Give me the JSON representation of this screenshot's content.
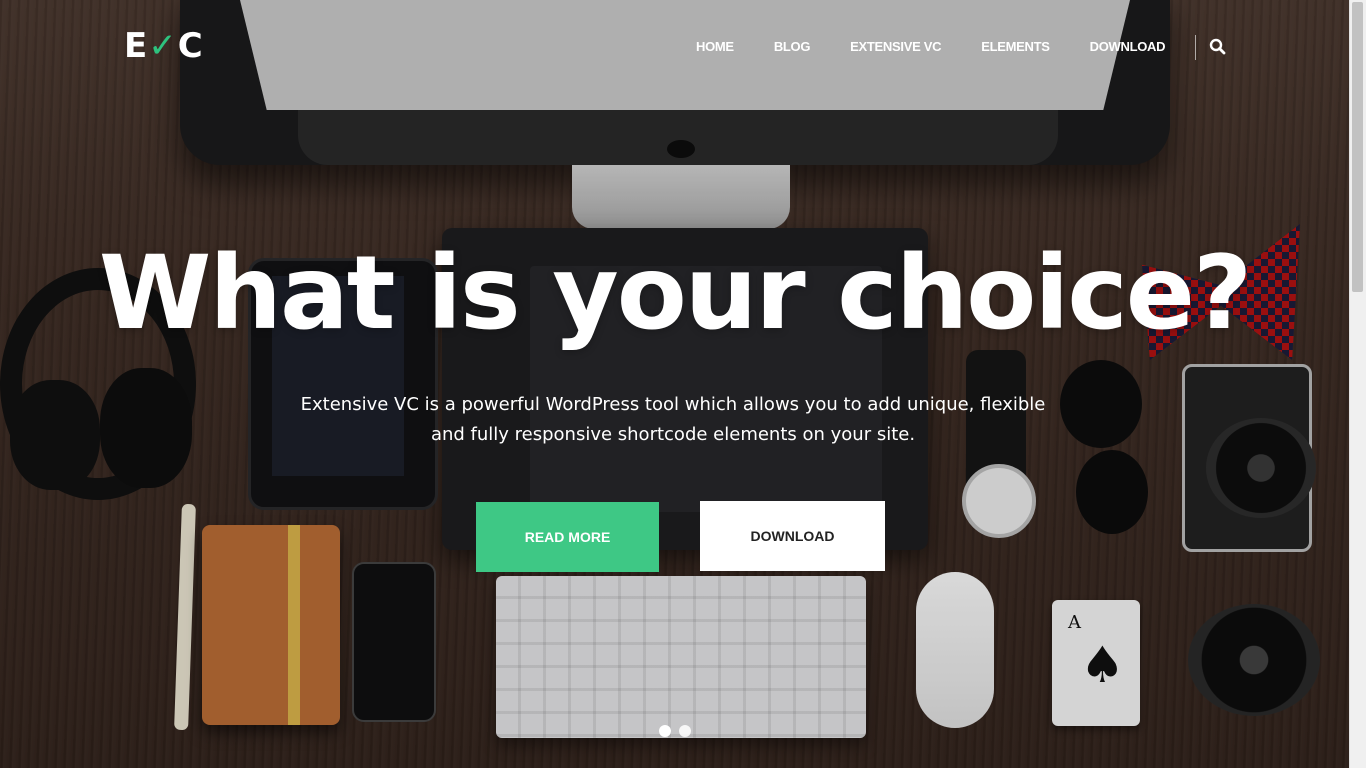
{
  "header": {
    "logo": {
      "prefix": "E",
      "check": "✓",
      "suffix": "C"
    },
    "nav": [
      {
        "label": "HOME"
      },
      {
        "label": "BLOG"
      },
      {
        "label": "EXTENSIVE VC"
      },
      {
        "label": "ELEMENTS"
      },
      {
        "label": "DOWNLOAD"
      }
    ],
    "search_icon": "search-icon"
  },
  "hero": {
    "headline": "What is your choice?",
    "subtext_line1": "Extensive VC is a powerful WordPress tool which allows you to add unique, flexible",
    "subtext_line2": "and fully responsive shortcode elements on your site.",
    "buttons": {
      "read_more": "READ MORE",
      "download": "DOWNLOAD"
    },
    "slider": {
      "dots": 2,
      "active": 1
    }
  },
  "colors": {
    "accent": "#3ec885",
    "logo_check": "#2ec27e",
    "text": "#ffffff",
    "download_btn_bg": "#ffffff",
    "download_btn_text": "#222222"
  },
  "background_image": "desk-flatlay-photo"
}
